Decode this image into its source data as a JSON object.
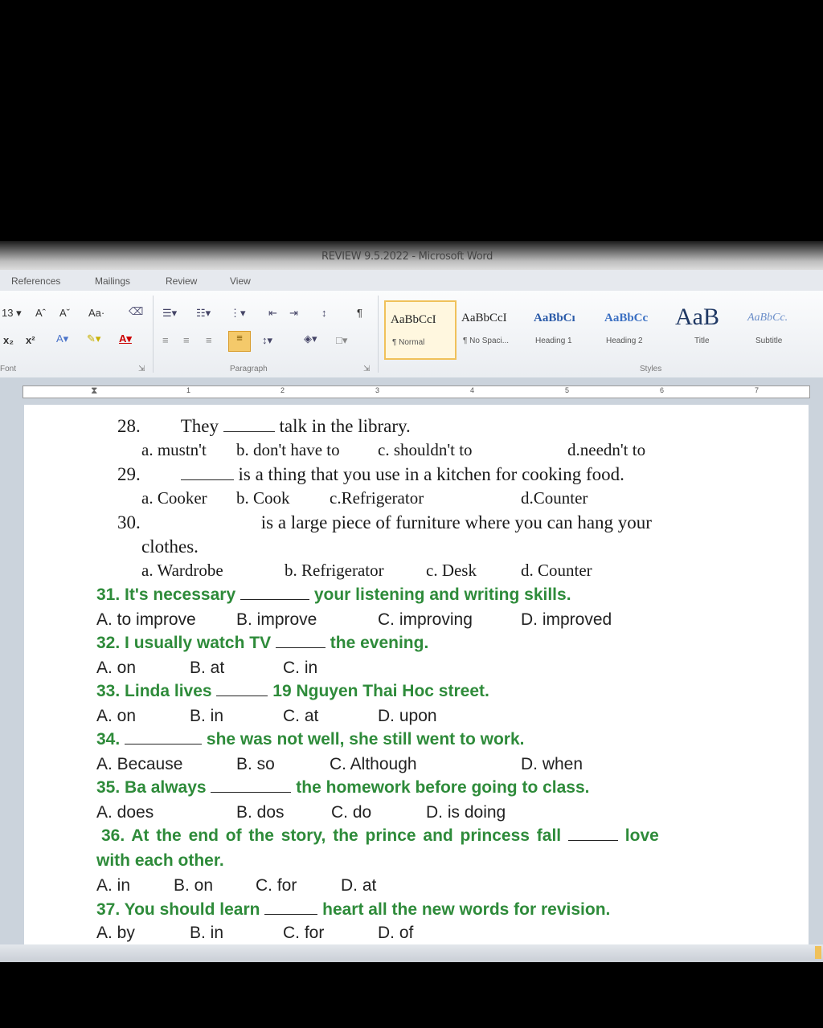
{
  "window": {
    "title": "REVIEW 9.5.2022 - Microsoft Word"
  },
  "ribbon_tabs": [
    "References",
    "Mailings",
    "Review",
    "View"
  ],
  "font_group": {
    "size": "13",
    "label": "Font",
    "grow": "Aˆ",
    "shrink": "Aˇ",
    "change_case": "Aa·",
    "subscript": "x₂",
    "superscript": "x²"
  },
  "paragraph_group": {
    "label": "Paragraph",
    "pilcrow": "¶"
  },
  "styles_group": {
    "label": "Styles",
    "items": [
      {
        "preview": "AaBbCcI",
        "name": "¶ Normal",
        "selected": true
      },
      {
        "preview": "AaBbCcI",
        "name": "¶ No Spaci...",
        "selected": false
      },
      {
        "preview": "AaBbCı",
        "name": "Heading 1",
        "selected": false
      },
      {
        "preview": "AaBbCc",
        "name": "Heading 2",
        "selected": false
      },
      {
        "preview": "AaB",
        "name": "Title",
        "selected": false
      },
      {
        "preview": "AaBbCc.",
        "name": "Subtitle",
        "selected": false
      }
    ]
  },
  "ruler": {
    "numbers": [
      "1",
      "2",
      "3",
      "4",
      "5",
      "6",
      "7"
    ]
  },
  "document": {
    "q28": {
      "num": "28.",
      "before": "They",
      "after": "talk in the library.",
      "options": [
        "a. mustn't",
        "b. don't have to",
        "c. shouldn't to",
        "d.needn't to"
      ]
    },
    "q29": {
      "num": "29.",
      "after": "is a thing that you use in a kitchen for cooking food.",
      "options": [
        "a. Cooker",
        "b. Cook",
        "c.Refrigerator",
        "d.Counter"
      ]
    },
    "q30": {
      "num": "30.",
      "after": "is a large piece of furniture where you can hang your",
      "cont": "clothes.",
      "options": [
        "a. Wardrobe",
        "b. Refrigerator",
        "c. Desk",
        "d. Counter"
      ]
    },
    "q31": {
      "before": "31. It's necessary",
      "after": "your listening and writing skills.",
      "options": [
        "A. to improve",
        "B. improve",
        "C. improving",
        "D. improved"
      ]
    },
    "q32": {
      "before": "32. I usually watch TV",
      "after": "the evening.",
      "options": [
        "A. on",
        "B. at",
        "C. in"
      ]
    },
    "q33": {
      "before": "33. Linda lives",
      "after": "19 Nguyen Thai Hoc street.",
      "options": [
        "A. on",
        "B. in",
        "C. at",
        "D. upon"
      ]
    },
    "q34": {
      "before": "34.",
      "after": "she was not well, she still went to work.",
      "options": [
        "A. Because",
        "B. so",
        "C. Although",
        "D. when"
      ]
    },
    "q35": {
      "before": "35. Ba always",
      "after": "the homework before going to class.",
      "options": [
        "A. does",
        "B. dos",
        "C. do",
        "D. is doing"
      ]
    },
    "q36": {
      "before": "36. At the end of the story, the prince and princess fall",
      "after": "love",
      "cont": "with each other.",
      "options": [
        "A. in",
        "B. on",
        "C. for",
        "D. at"
      ]
    },
    "q37": {
      "before": "37. You should learn",
      "after": "heart all the new words for revision.",
      "options": [
        "A. by",
        "B. in",
        "C. for",
        "D. of"
      ]
    }
  }
}
